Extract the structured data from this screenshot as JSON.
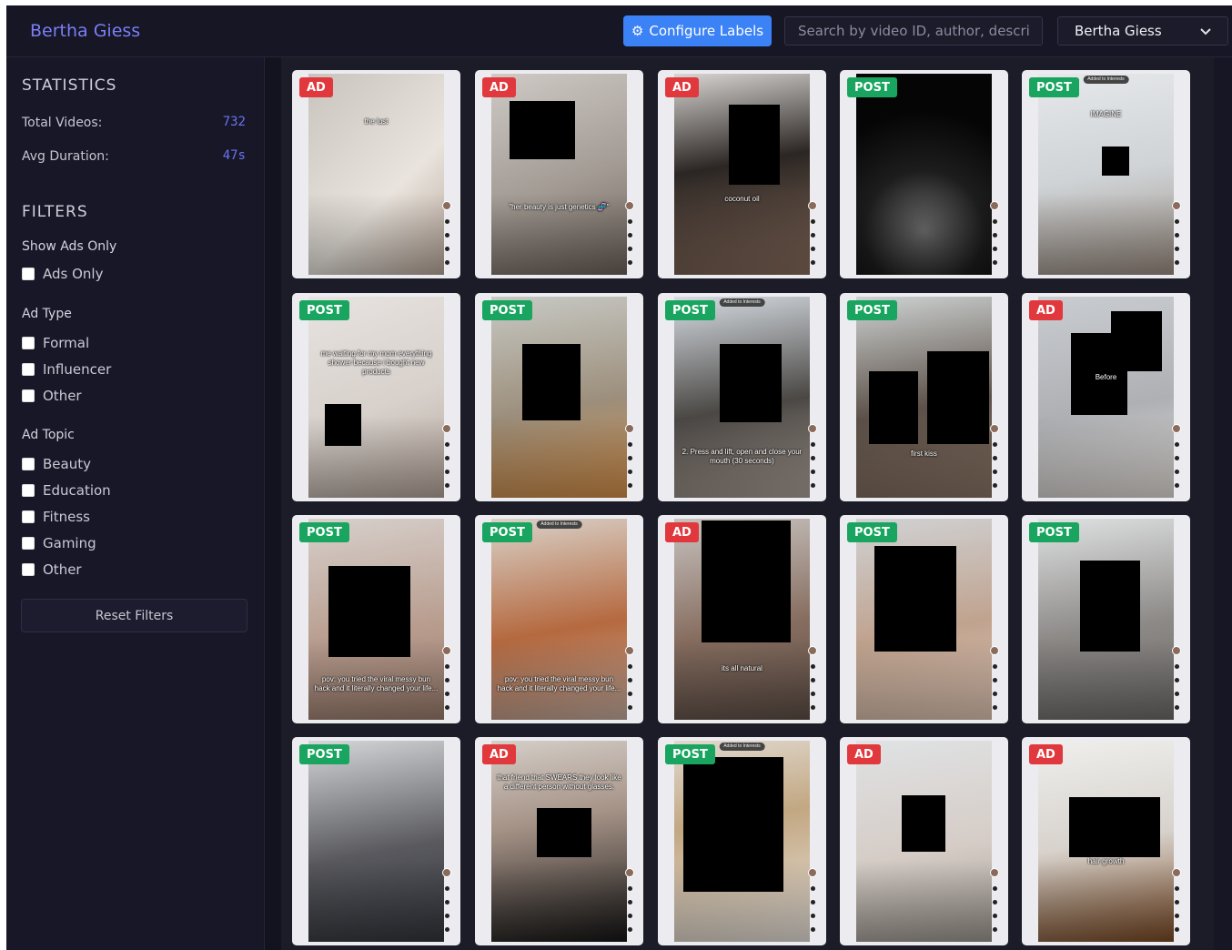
{
  "header": {
    "brand": "Bertha Giess",
    "configure_label": "Configure Labels",
    "search_placeholder": "Search by video ID, author, description",
    "user_selected": "Bertha Giess"
  },
  "sidebar": {
    "statistics_title": "STATISTICS",
    "total_videos_label": "Total Videos:",
    "total_videos_value": "732",
    "avg_duration_label": "Avg Duration:",
    "avg_duration_value": "47s",
    "filters_title": "FILTERS",
    "show_ads_title": "Show Ads Only",
    "ads_only_label": "Ads Only",
    "ad_type_title": "Ad Type",
    "ad_type_options": [
      "Formal",
      "Influencer",
      "Other"
    ],
    "ad_topic_title": "Ad Topic",
    "ad_topic_options": [
      "Beauty",
      "Education",
      "Fitness",
      "Gaming",
      "Other"
    ],
    "reset_label": "Reset Filters"
  },
  "colors": {
    "accent": "#3b82f6",
    "brand": "#7b7ff6",
    "ad_badge": "#e0383c",
    "post_badge": "#19a55f"
  },
  "cards": [
    {
      "badge": "AD",
      "caption": "the lust",
      "pill": ""
    },
    {
      "badge": "AD",
      "caption": "\"her beauty is just genetics 🧬\"",
      "pill": ""
    },
    {
      "badge": "AD",
      "caption": "coconut oil",
      "pill": ""
    },
    {
      "badge": "POST",
      "caption": "",
      "pill": ""
    },
    {
      "badge": "POST",
      "caption": "IMAGINE",
      "pill": "Added to Interests"
    },
    {
      "badge": "POST",
      "caption": "me waiting for my mom everything shower because i bought new products",
      "pill": ""
    },
    {
      "badge": "POST",
      "caption": "",
      "pill": ""
    },
    {
      "badge": "POST",
      "caption": "2. Press and lift, open and close your mouth (30 seconds)",
      "pill": "Added to Interests"
    },
    {
      "badge": "POST",
      "caption": "first kiss",
      "pill": ""
    },
    {
      "badge": "AD",
      "caption": "Before",
      "pill": ""
    },
    {
      "badge": "POST",
      "caption": "pov: you tried the viral messy bun hack and it literally changed your life...",
      "pill": ""
    },
    {
      "badge": "POST",
      "caption": "pov: you tried the viral messy bun hack and it literally changed your life...",
      "pill": "Added to Interests"
    },
    {
      "badge": "AD",
      "caption": "its all natural",
      "pill": ""
    },
    {
      "badge": "POST",
      "caption": "",
      "pill": ""
    },
    {
      "badge": "POST",
      "caption": "",
      "pill": ""
    },
    {
      "badge": "POST",
      "caption": "",
      "pill": ""
    },
    {
      "badge": "AD",
      "caption": "that friend that SWEARS they look like a different person without glasses.",
      "pill": ""
    },
    {
      "badge": "POST",
      "caption": "",
      "pill": "Added to Interests"
    },
    {
      "badge": "AD",
      "caption": "",
      "pill": ""
    },
    {
      "badge": "AD",
      "caption": "hair growth",
      "pill": ""
    }
  ]
}
